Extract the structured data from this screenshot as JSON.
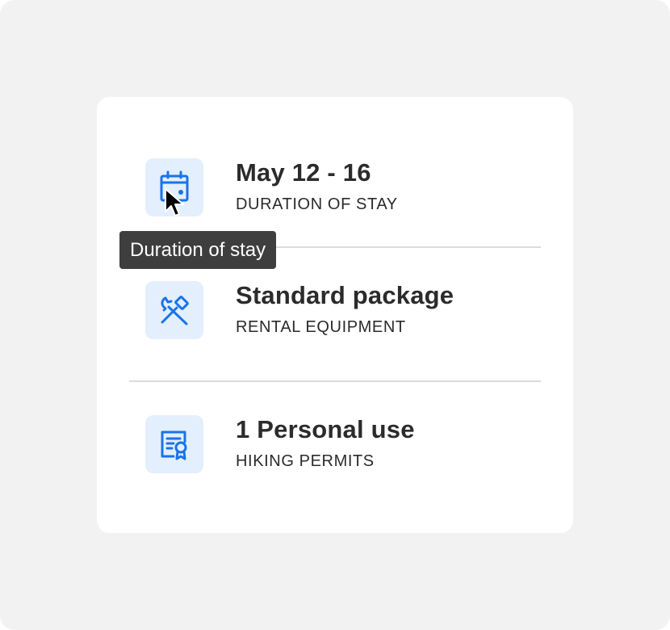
{
  "items": [
    {
      "title": "May 12 - 16",
      "subtitle": "DURATION OF STAY",
      "icon": "calendar-icon"
    },
    {
      "title": "Standard package",
      "subtitle": "RENTAL EQUIPMENT",
      "icon": "tools-icon"
    },
    {
      "title": "1 Personal use",
      "subtitle": "HIKING PERMITS",
      "icon": "certificate-icon"
    }
  ],
  "tooltip": {
    "text": "Duration of stay"
  },
  "colors": {
    "accent": "#1a73e8",
    "icon_tile": "#e3effd",
    "text": "#2b2b2b",
    "tooltip_bg": "#3e3e3e",
    "background": "#f2f2f2"
  }
}
